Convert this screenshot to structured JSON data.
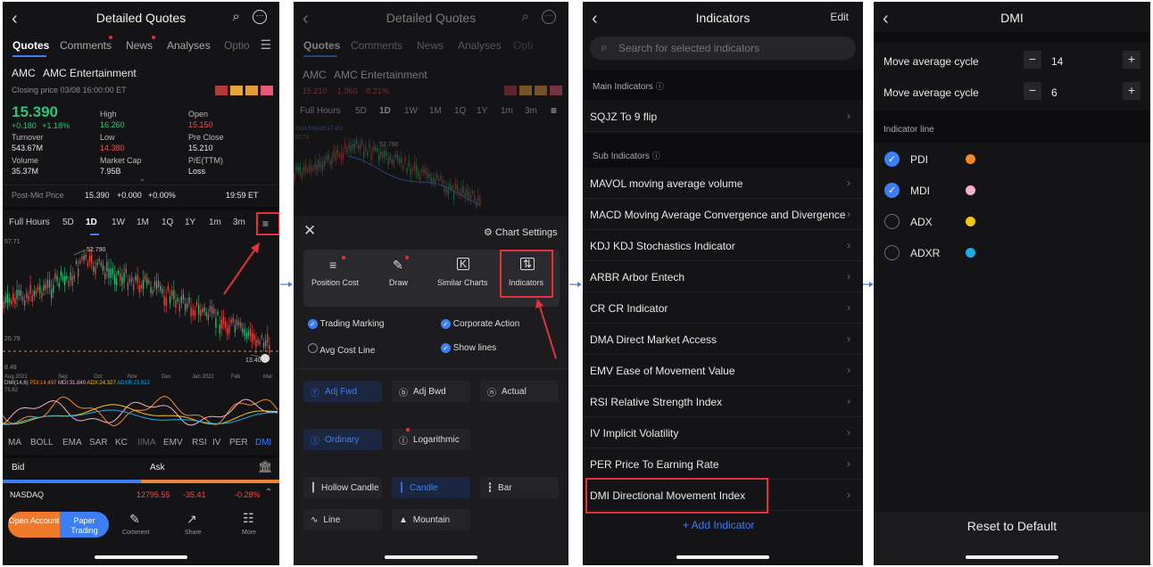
{
  "screen1": {
    "title": "Detailed Quotes",
    "tabs": [
      "Quotes",
      "Comments",
      "News",
      "Analyses",
      "Optio"
    ],
    "ticker": "AMC",
    "company": "AMC Entertainment",
    "closing": "Closing price 03/08 16:00:00 ET",
    "price": "15.390",
    "change": "+0.180",
    "change_pct": "+1.18%",
    "stats": {
      "high_label": "High",
      "high": "16.260",
      "open_label": "Open",
      "open": "15.150",
      "turnover_label": "Turnover",
      "turnover": "543.67M",
      "low_label": "Low",
      "low": "14.380",
      "preclose_label": "Pre Close",
      "preclose": "15.210",
      "volume_label": "Volume",
      "volume": "35.37M",
      "mktcap_label": "Market Cap",
      "mktcap": "7.95B",
      "pe_label": "P/E(TTM)",
      "pe": "Loss"
    },
    "postmkt_label": "Post-Mkt Price",
    "postmkt_price": "15.390",
    "postmkt_change": "+0.000",
    "postmkt_pct": "+0.00%",
    "postmkt_time": "19:59 ET",
    "periods": [
      "Full Hours",
      "5D",
      "1D",
      "1W",
      "1M",
      "1Q",
      "1Y",
      "1m",
      "3m"
    ],
    "chart_top": "57.71",
    "chart_hi": "52.790",
    "chart_mid": "20.79",
    "chart_low": "13.40",
    "chart_bottom": "8.48",
    "months": [
      "Aug 2021",
      "Sep",
      "Oct",
      "Nov",
      "Dec",
      "Jan 2022",
      "Feb",
      "Mar"
    ],
    "dmi_legend": "DMI(14,6)",
    "dmi_pdi": "PDI:14.497",
    "dmi_mdi": "MDI:31.840",
    "dmi_adx": "ADX:24.327",
    "dmi_adxr": "ADXR:23.812",
    "dmi_top": "75.82",
    "indicator_tabs": [
      "MA",
      "BOLL",
      "EMA",
      "SAR",
      "KC",
      "IIMA",
      "EMV",
      "RSI",
      "IV",
      "PER",
      "DMI"
    ],
    "bid": "Bid",
    "ask": "Ask",
    "index_name": "NASDAQ",
    "index_price": "12795.55",
    "index_change": "-35.41",
    "index_pct": "-0.28%",
    "open_account": "Open Account",
    "paper_trading": "Paper Trading",
    "comment": "Comment",
    "share": "Share",
    "more": "More"
  },
  "screen2": {
    "title": "Detailed Quotes",
    "tabs": [
      "Quotes",
      "Comments",
      "News",
      "Analyses",
      "Opti"
    ],
    "ticker": "AMC",
    "company": "AMC Entertainment",
    "price": "15.210",
    "change": "-1.360",
    "change_pct": "-8.21%",
    "periods": [
      "Full Hours",
      "5D",
      "1D",
      "1W",
      "1M",
      "1Q",
      "1Y",
      "1m",
      "3m"
    ],
    "ema_label": "EMA  EMA20:17.451",
    "chart_top": "57.71",
    "chart_hi": "52.790",
    "chart_settings": "Chart Settings",
    "tools": [
      "Position Cost",
      "Draw",
      "Similar Charts",
      "Indicators"
    ],
    "checks": [
      "Trading Marking",
      "Corporate Action",
      "Avg Cost Line",
      "Show lines"
    ],
    "adjust": [
      "Adj Fwd",
      "Adj Bwd",
      "Actual"
    ],
    "scale": [
      "Ordinary",
      "Logarithmic"
    ],
    "styles": [
      "Hollow Candle",
      "Candle",
      "Bar",
      "Line",
      "Mountain"
    ]
  },
  "screen3": {
    "title": "Indicators",
    "edit": "Edit",
    "search_placeholder": "Search for selected indicators",
    "main_header": "Main Indicators",
    "main_items": [
      "SQJZ To 9 flip"
    ],
    "sub_header": "Sub Indicators",
    "sub_items": [
      "MAVOL moving average volume",
      "MACD Moving Average Convergence and Divergence",
      "KDJ KDJ Stochastics Indicator",
      "ARBR Arbor Entech",
      "CR CR Indicator",
      "DMA Direct Market Access",
      "EMV Ease of Movement Value",
      "RSI Relative Strength Index",
      "IV Implicit Volatility",
      "PER Price To Earning Rate",
      "DMI Directional Movement Index"
    ],
    "add": "+ Add Indicator"
  },
  "screen4": {
    "title": "DMI",
    "cycles": [
      {
        "label": "Move average cycle",
        "value": "14"
      },
      {
        "label": "Move average cycle",
        "value": "6"
      }
    ],
    "line_header": "Indicator line",
    "lines": [
      {
        "name": "PDI",
        "checked": true,
        "color": "#f5882a"
      },
      {
        "name": "MDI",
        "checked": true,
        "color": "#f7b0c8"
      },
      {
        "name": "ADX",
        "checked": false,
        "color": "#f5c518"
      },
      {
        "name": "ADXR",
        "checked": false,
        "color": "#1fa9e6"
      }
    ],
    "reset": "Reset to Default"
  }
}
